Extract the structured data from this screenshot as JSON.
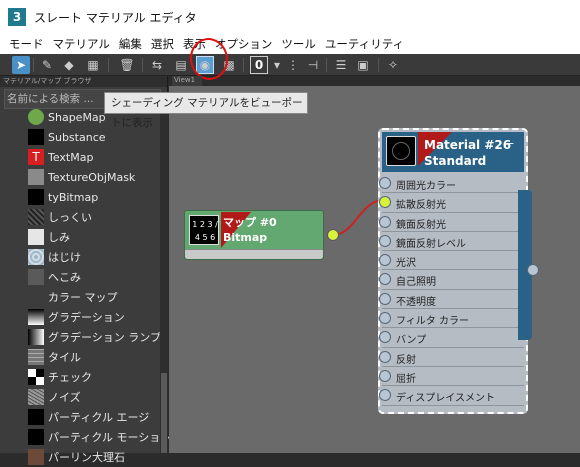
{
  "window": {
    "app_icon_text": "3",
    "title": "スレート マテリアル エディタ"
  },
  "menu": [
    "モード",
    "マテリアル",
    "編集",
    "選択",
    "表示",
    "オプション",
    "ツール",
    "ユーティリティ"
  ],
  "toolbar": {
    "counter_value": "0"
  },
  "browser": {
    "header": "マテリアル/マップ ブラウザ",
    "search_placeholder": "名前による検索 ...",
    "items": [
      {
        "label": "ShapeMap",
        "thumb": "#6fa84a"
      },
      {
        "label": "Substance",
        "thumb": "#000000"
      },
      {
        "label": "TextMap",
        "thumb": "#d81e1e"
      },
      {
        "label": "TextureObjMask",
        "thumb": "#8a8a8a"
      },
      {
        "label": "tyBitmap",
        "thumb": "#000000"
      },
      {
        "label": "しっくい",
        "thumb": "#2c2c2c"
      },
      {
        "label": "しみ",
        "thumb": "#e6e6e6"
      },
      {
        "label": "はじけ",
        "thumb": "#9fb7c7"
      },
      {
        "label": "へこみ",
        "thumb": "#5a5a5a"
      },
      {
        "label": "カラー マップ",
        "thumb": "#3c3c3c"
      },
      {
        "label": "グラデーション",
        "thumb": "#bdbdbd"
      },
      {
        "label": "グラデーション ランプ",
        "thumb": "#aaaaaa"
      },
      {
        "label": "タイル",
        "thumb": "#8c8c8c"
      },
      {
        "label": "チェック",
        "thumb": "#ffffff"
      },
      {
        "label": "ノイズ",
        "thumb": "#7a7a7a"
      },
      {
        "label": "パーティクル エージ",
        "thumb": "#000000"
      },
      {
        "label": "パーティクル モーション...",
        "thumb": "#000000"
      },
      {
        "label": "パーリン大理石",
        "thumb": "#6b4a3a"
      }
    ]
  },
  "tooltip": "シェーディング マテリアルをビューポートに表示",
  "view_tab": "View1",
  "bitmap_node": {
    "name": "マップ #0",
    "type": "Bitmap",
    "icon_text": "1 2 3 / 4 5 6"
  },
  "material_node": {
    "name": "Material #26",
    "type": "Standard",
    "minimize": "–",
    "slots": [
      "周囲光カラー",
      "拡散反射光",
      "鏡面反射光",
      "鏡面反射レベル",
      "光沢",
      "自己照明",
      "不透明度",
      "フィルタ カラー",
      "バンプ",
      "反射",
      "屈折",
      "ディスプレイスメント"
    ],
    "connected_slot_index": 1
  },
  "colors": {
    "accent": "#4a90c8",
    "material_header": "#2a6186",
    "bitmap_node": "#62a870",
    "socket_hot": "#d6f23a",
    "wire": "#cc2222"
  }
}
